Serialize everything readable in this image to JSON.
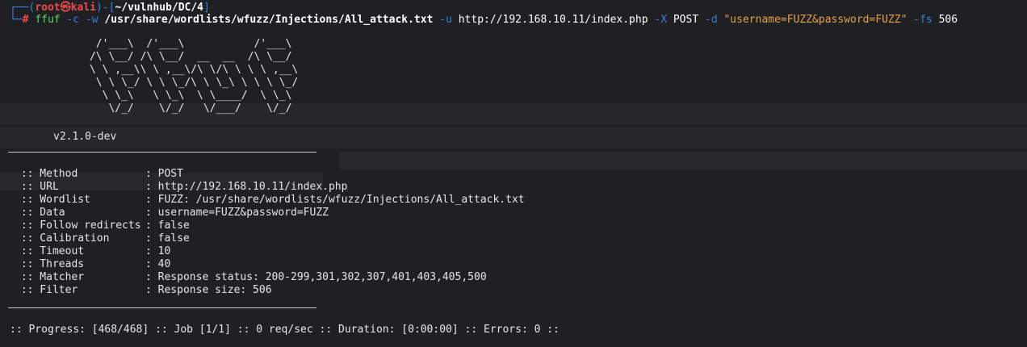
{
  "prompt": {
    "frame_top": "┌──(",
    "user": "root㉿kali",
    "frame_mid": ")-[",
    "cwd": "~/vulnhub/DC/4",
    "frame_end": "]",
    "frame_bottom": "└─",
    "hash": "#"
  },
  "command": {
    "program": "ffuf",
    "flag_c": "-c",
    "flag_w": "-w",
    "wordlist": "/usr/share/wordlists/wfuzz/Injections/All_attack.txt",
    "flag_u": "-u",
    "url": "http://192.168.10.11/index.php",
    "flag_x": "-X",
    "method": "POST",
    "flag_d": "-d",
    "data": "\"username=FUZZ&password=FUZZ\"",
    "flag_fs": "-fs",
    "filter_size": "506"
  },
  "banner": {
    "ascii": "       /'___\\  /'___\\           /'___\\       \n      /\\ \\__/ /\\ \\__/  __  __  /\\ \\__/       \n      \\ \\ ,__\\\\ \\ ,__\\/\\ \\/\\ \\ \\ \\ ,__\\      \n       \\ \\ \\_/ \\ \\ \\_/\\ \\ \\_\\ \\ \\ \\ \\_/      \n        \\ \\_\\   \\ \\_\\  \\ \\____/  \\ \\_\\       \n         \\/_/    \\/_/   \\/___/    \\/_/       ",
    "version": "v2.1.0-dev"
  },
  "config": [
    {
      "key": " :: Method",
      "value": ": POST"
    },
    {
      "key": " :: URL",
      "value": ": http://192.168.10.11/index.php"
    },
    {
      "key": " :: Wordlist",
      "value": ": FUZZ: /usr/share/wordlists/wfuzz/Injections/All_attack.txt"
    },
    {
      "key": " :: Data",
      "value": ": username=FUZZ&password=FUZZ"
    },
    {
      "key": " :: Follow redirects",
      "value": ": false"
    },
    {
      "key": " :: Calibration",
      "value": ": false"
    },
    {
      "key": " :: Timeout",
      "value": ": 10"
    },
    {
      "key": " :: Threads",
      "value": ": 40"
    },
    {
      "key": " :: Matcher",
      "value": ": Response status: 200-299,301,302,307,401,403,405,500"
    },
    {
      "key": " :: Filter",
      "value": ": Response size: 506"
    }
  ],
  "progress": ":: Progress: [468/468] :: Job [1/1] :: 0 req/sec :: Duration: [0:00:00] :: Errors: 0 ::",
  "colors": {
    "background": "#1f2024",
    "prompt_frame": "#3b7ddd",
    "prompt_user": "#ee4b4b",
    "command": "#5fd75f",
    "string": "#e5a04a"
  }
}
